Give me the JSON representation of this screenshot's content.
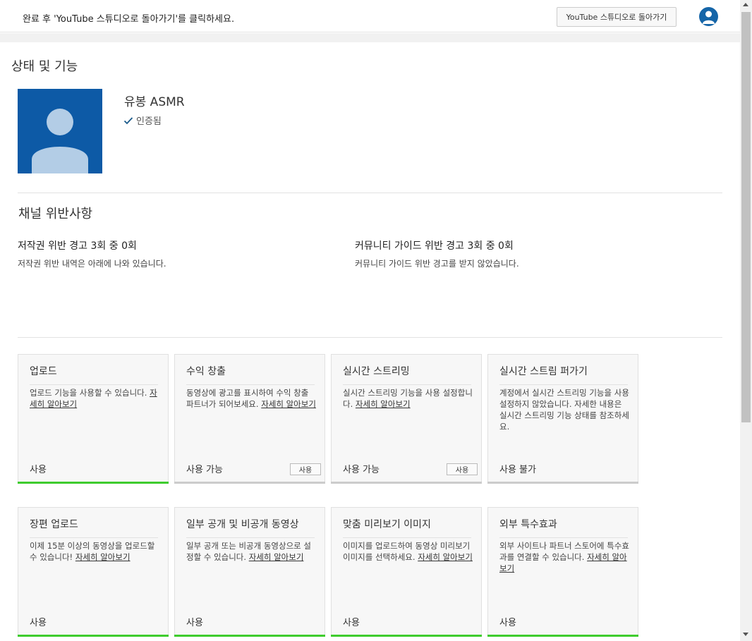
{
  "topbar": {
    "message": "완료 후 'YouTube 스튜디오로 돌아가기'를 클릭하세요.",
    "back_button": "YouTube 스튜디오로 돌아가기"
  },
  "page_title": "상태 및 기능",
  "channel": {
    "name": "유봉 ASMR",
    "verified_label": "인증됨"
  },
  "violations": {
    "title": "채널 위반사항",
    "copyright": {
      "heading": "저작권 위반 경고 3회 중 0회",
      "detail": "저작권 위반 내역은 아래에 나와 있습니다."
    },
    "community": {
      "heading": "커뮤니티 가이드 위반 경고 3회 중 0회",
      "detail": "커뮤니티 가이드 위반 경고를 받지 않았습니다."
    }
  },
  "features": [
    {
      "title": "업로드",
      "desc": "업로드 기능을 사용할 수 있습니다. ",
      "link": "자세히 알아보기",
      "status": "사용",
      "button": "",
      "bar_color": "#3fcc2e"
    },
    {
      "title": "수익 창출",
      "desc": "동영상에 광고를 표시하여 수익 창출 파트너가 되어보세요. ",
      "link": "자세히 알아보기",
      "status": "사용 가능",
      "button": "사용",
      "bar_color": "#cccccc"
    },
    {
      "title": "실시간 스트리밍",
      "desc": "실시간 스트리밍 기능을 사용 설정합니다. ",
      "link": "자세히 알아보기",
      "status": "사용 가능",
      "button": "사용",
      "bar_color": "#cccccc"
    },
    {
      "title": "실시간 스트림 퍼가기",
      "desc": "계정에서 실시간 스트리밍 기능을 사용 설정하지 않았습니다. 자세한 내용은 실시간 스트리밍 기능 상태를 참조하세요.",
      "link": "",
      "status": "사용 불가",
      "button": "",
      "bar_color": "#cccccc"
    },
    {
      "title": "장편 업로드",
      "desc": "이제 15분 이상의 동영상을 업로드할 수 있습니다! ",
      "link": "자세히 알아보기",
      "status": "사용",
      "button": "",
      "bar_color": "#3fcc2e"
    },
    {
      "title": "일부 공개 및 비공개 동영상",
      "desc": "일부 공개 또는 비공개 동영상으로 설정할 수 있습니다. ",
      "link": "자세히 알아보기",
      "status": "사용",
      "button": "",
      "bar_color": "#3fcc2e"
    },
    {
      "title": "맞춤 미리보기 이미지",
      "desc": "이미지를 업로드하여 동영상 미리보기 이미지를 선택하세요. ",
      "link": "자세히 알아보기",
      "status": "사용",
      "button": "",
      "bar_color": "#3fcc2e"
    },
    {
      "title": "외부 특수효과",
      "desc": "외부 사이트나 파트너 스토어에 특수효과를 연결할 수 있습니다. ",
      "link": "자세히 알아보기",
      "status": "사용",
      "button": "",
      "bar_color": "#3fcc2e"
    }
  ]
}
